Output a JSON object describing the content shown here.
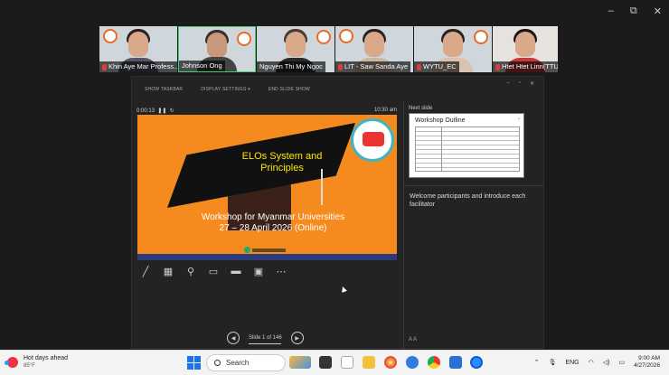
{
  "window_controls": {
    "minimize": "–",
    "restore": "⧉",
    "close": "✕"
  },
  "participants": [
    {
      "name": "Khin Aye Mar Profess...",
      "muted": true,
      "active": false
    },
    {
      "name": "Johnson Ong",
      "muted": false,
      "active": true
    },
    {
      "name": "Nguyen Thi My Ngoc",
      "muted": false,
      "active": false
    },
    {
      "name": "LIT - Saw Sanda Aye",
      "muted": true,
      "active": false
    },
    {
      "name": "WYTU_EC",
      "muted": true,
      "active": false
    },
    {
      "name": "Htet Htet Linn(TTU)",
      "muted": true,
      "active": false
    }
  ],
  "presenter": {
    "toolbar": {
      "show_taskbar": "SHOW TASKBAR",
      "display_settings": "DISPLAY SETTINGS ▾",
      "end_show": "END SLIDE SHOW"
    },
    "win_buttons": {
      "minimize": "–",
      "restore": "▫",
      "close": "✕"
    },
    "elapsed": "0:00:13",
    "pause_icon": "pause-icon",
    "reset_icon": "reset-icon",
    "clock": "10:30 am",
    "current_slide": {
      "title_line1": "ELOs System and",
      "title_line2": "Principles",
      "subtitle_line1": "Workshop for Myanmar Universities",
      "subtitle_line2": "27 – 28 April 2026 (Online)",
      "bg_color": "#f58b1f"
    },
    "tools": [
      "pen-icon",
      "grid-icon",
      "zoom-icon",
      "camera-toggle-icon",
      "subtitles-icon",
      "video-icon",
      "more-icon"
    ],
    "nav": {
      "prev": "◀",
      "counter": "Slide 1 of 146",
      "next": "▶"
    },
    "next_slide_label": "Next slide",
    "next_slide_title": "Workshop Outline",
    "notes": "Welcome participants and introduce each facilitator",
    "font_ctrl": "A  A"
  },
  "taskbar": {
    "weather_title": "Hot days ahead",
    "weather_temp": "85°F",
    "search_placeholder": "Search",
    "lang": "ENG",
    "time": "9:00 AM",
    "date": "4/27/2026"
  }
}
